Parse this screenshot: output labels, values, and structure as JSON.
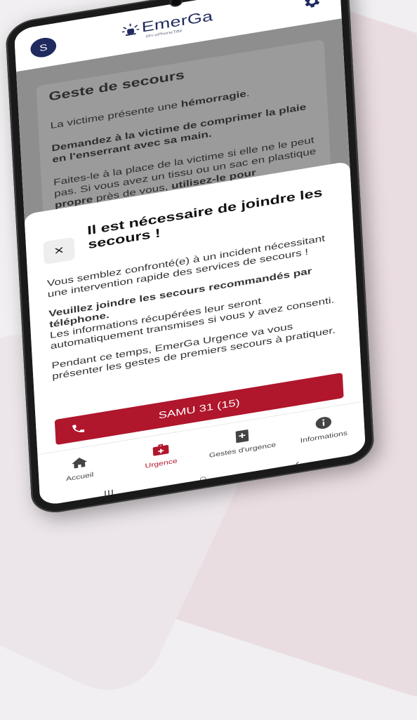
{
  "colors": {
    "brand": "#1f2a5e",
    "emergency": "#b0162c",
    "background": "#f1eff1"
  },
  "header": {
    "avatar_initial": "S",
    "logo_text": "EmerGa",
    "logo_sub": "#Fr-ePhoneTitle",
    "settings_icon": "gear-icon"
  },
  "background_page": {
    "card_title": "Geste de secours",
    "p1_start": "La victime présente une ",
    "p1_bold": "hémorragie",
    "p1_end": ".",
    "p2": "Demandez à la victime de comprimer la plaie en l'enserrant avec sa main.",
    "p3_start": "Faites-le à la place de la victime si elle ne le peut pas. Si vous avez un tissu ou un sac en plastique ",
    "p3_bold1": "propre",
    "p3_mid": " près de vous, ",
    "p3_bold2": "utilisez-le pour comprimer la plaie."
  },
  "modal": {
    "close_label": "×",
    "title": "Il est nécessaire de joindre les secours !",
    "para1": "Vous semblez confronté(e) à un incident nécessitant une intervention rapide des services de secours !",
    "para2_bold": "Veuillez joindre les secours recommandés par téléphone.",
    "para2_rest": "Les informations récupérées leur seront automatiquement transmises si vous y avez consenti.",
    "para3": "Pendant ce temps, EmerGa Urgence va vous présenter les gestes de premiers secours à pratiquer.",
    "cta_label": "SAMU 31 (15)",
    "cta_icon": "phone-icon"
  },
  "tabbar": {
    "tabs": [
      {
        "label": "Accueil",
        "icon": "home-icon",
        "active": false
      },
      {
        "label": "Urgence",
        "icon": "first-aid-kit-icon",
        "active": true
      },
      {
        "label": "Gestes d'urgence",
        "icon": "medical-book-icon",
        "active": false
      },
      {
        "label": "Informations",
        "icon": "info-icon",
        "active": false
      }
    ]
  },
  "system_nav": {
    "recent": "|||",
    "home": "○",
    "back": "‹"
  }
}
